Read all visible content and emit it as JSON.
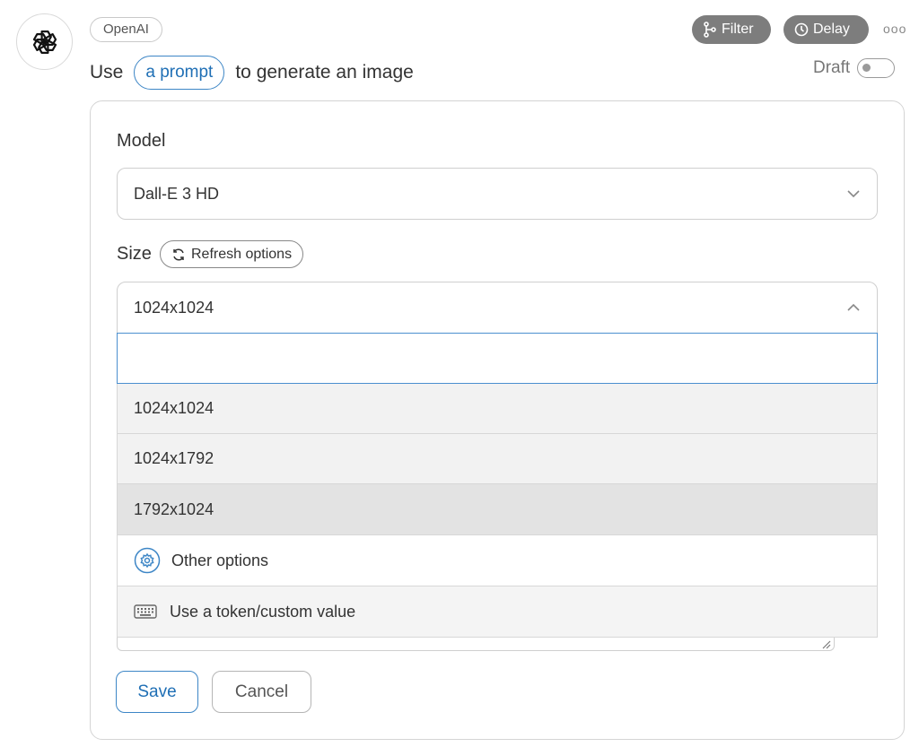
{
  "header": {
    "provider": "OpenAI",
    "title_prefix": "Use",
    "prompt_chip": "a prompt",
    "title_suffix": "to generate an image",
    "filter_label": "Filter",
    "delay_label": "Delay",
    "more_label": "ooo",
    "draft_label": "Draft"
  },
  "form": {
    "model_label": "Model",
    "model_value": "Dall-E 3 HD",
    "size_label": "Size",
    "refresh_label": "Refresh options",
    "size_value": "1024x1024",
    "search_placeholder": "",
    "size_options": [
      "1024x1024",
      "1024x1792",
      "1792x1024"
    ],
    "other_options_label": "Other options",
    "custom_value_label": "Use a token/custom value"
  },
  "actions": {
    "save_label": "Save",
    "cancel_label": "Cancel"
  },
  "colors": {
    "accent": "#1f6fb5",
    "header_buttons": "#7d7d7d"
  }
}
